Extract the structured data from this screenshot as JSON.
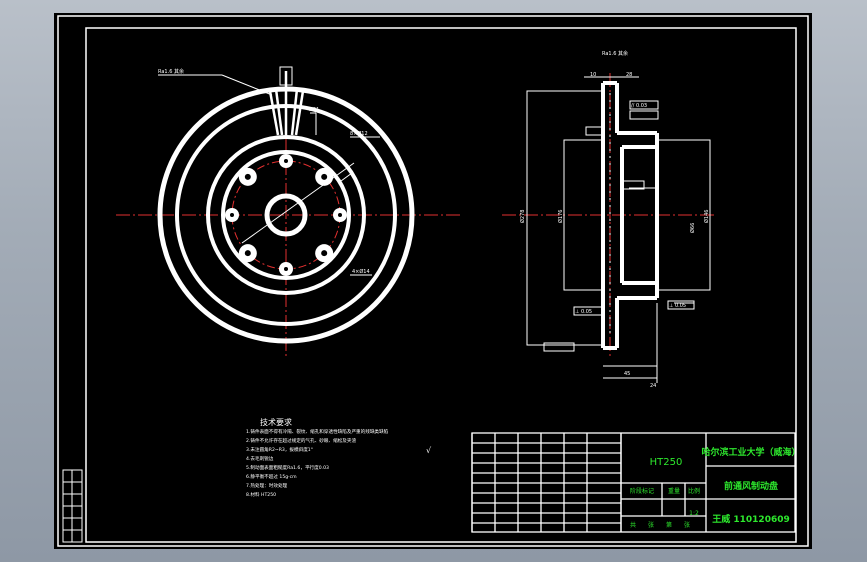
{
  "colors": {
    "background": "#a3acb7",
    "sheet": "#000000",
    "line": "#ffffff",
    "centerline": "#e23030",
    "title_text": "#2de82d"
  },
  "title_block": {
    "material": "HT250",
    "school": "哈尔滨工业大学（威海）",
    "part_name": "前通风制动盘",
    "author": "王威 110120609",
    "scale": "1:2",
    "row_labels": [
      "阶段标记",
      "重量",
      "比例"
    ],
    "sheet_labels": [
      "共",
      "张",
      "第",
      "张"
    ]
  },
  "notes": {
    "title": "技术要求",
    "lines": [
      "1.铸件表面不得有冷隔、裂纹、缩孔和穿透性缺陷及严重的残缺类缺陷",
      "2.铸件不允许存在超过规定的气孔、砂眼、缩松及夹渣",
      "3.未注圆角R2~R3，拔模斜度1°",
      "4.去毛刺锐边",
      "5.制动面表面粗糙度Ra1.6，平行度0.03",
      "6.静平衡不超过 15g·cm",
      "7.热处理：时效处理",
      "8.材料 HT250"
    ]
  },
  "front_view": {
    "labels": {
      "top_dim": "Ø21",
      "bolt_pcd": "8×Ø12",
      "hole": "4×Ø14",
      "note_left": "Ra1.6 其余"
    }
  },
  "section_view": {
    "labels": {
      "heading": "Ra1.6 其余",
      "d_outer": "Ø278",
      "d_hub": "Ø146",
      "d_bore": "Ø66",
      "d_inner": "Ø176",
      "t1": "10",
      "t2": "28",
      "w1": "45",
      "w2": "24",
      "flat_top": "// 0.03",
      "flat_mid": "⊥ 0.05",
      "flat_bottom": "⊥ 0.05"
    }
  }
}
